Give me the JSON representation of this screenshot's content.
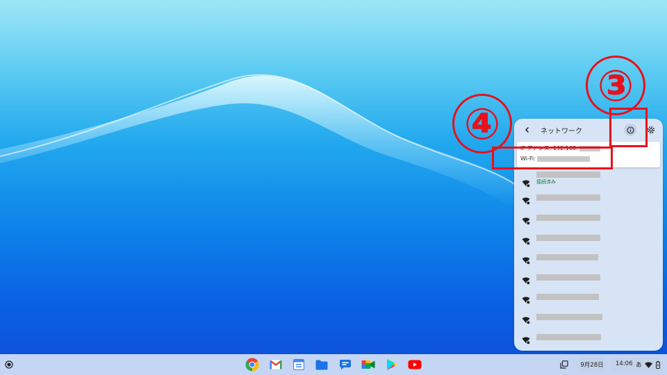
{
  "network_panel": {
    "title": "ネットワーク",
    "info_popup": {
      "ip_label": "IP アドレス: 192.168.",
      "wifi_label": "Wi-Fi:"
    },
    "connected_status": "接続済み",
    "network_count": 10
  },
  "annotations": {
    "marker_3": "③",
    "marker_4": "④",
    "color": "#e8101a"
  },
  "shelf": {
    "apps": [
      "chrome-icon",
      "gmail-icon",
      "calendar-icon",
      "files-icon",
      "messages-icon",
      "meet-icon",
      "play-store-icon",
      "youtube-icon"
    ],
    "date": "9月28日",
    "time": "14:06",
    "ime": "あ"
  }
}
